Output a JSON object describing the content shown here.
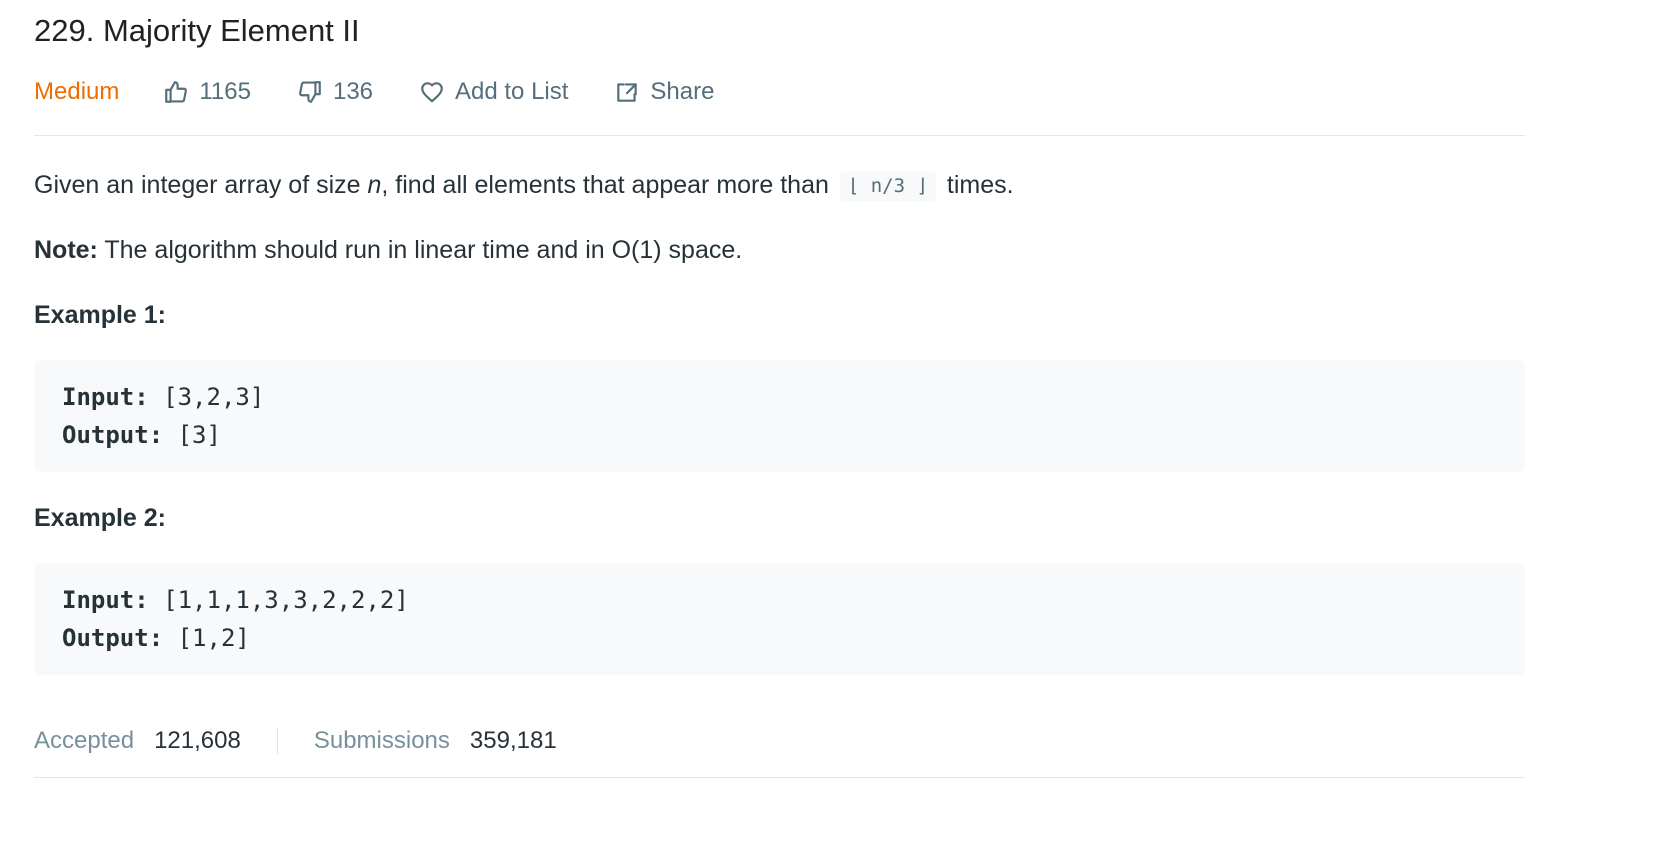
{
  "problem": {
    "title": "229. Majority Element II",
    "difficulty": "Medium",
    "likes": "1165",
    "dislikes": "136",
    "add_to_list_label": "Add to List",
    "share_label": "Share",
    "colors": {
      "difficulty": "#ef6c00",
      "text": "#263238",
      "muted": "#546e7a",
      "code_bg": "#f7f9fa"
    }
  },
  "description": {
    "part1": "Given an integer array of size ",
    "var_n": "n",
    "part2": ", find all elements that appear more than ",
    "inline_code": "⌊ n/3 ⌋",
    "part3": " times."
  },
  "note": {
    "label": "Note:",
    "text": " The algorithm should run in linear time and in O(1) space."
  },
  "examples": [
    {
      "heading": "Example 1:",
      "input_label": "Input:",
      "input_value": " [3,2,3]",
      "output_label": "Output:",
      "output_value": " [3]"
    },
    {
      "heading": "Example 2:",
      "input_label": "Input:",
      "input_value": " [1,1,1,3,3,2,2,2]",
      "output_label": "Output:",
      "output_value": " [1,2]"
    }
  ],
  "stats": {
    "accepted_label": "Accepted",
    "accepted_value": "121,608",
    "submissions_label": "Submissions",
    "submissions_value": "359,181"
  },
  "icons": {
    "like": "thumbs-up-icon",
    "dislike": "thumbs-down-icon",
    "add_to_list": "heart-icon",
    "share": "share-icon"
  }
}
